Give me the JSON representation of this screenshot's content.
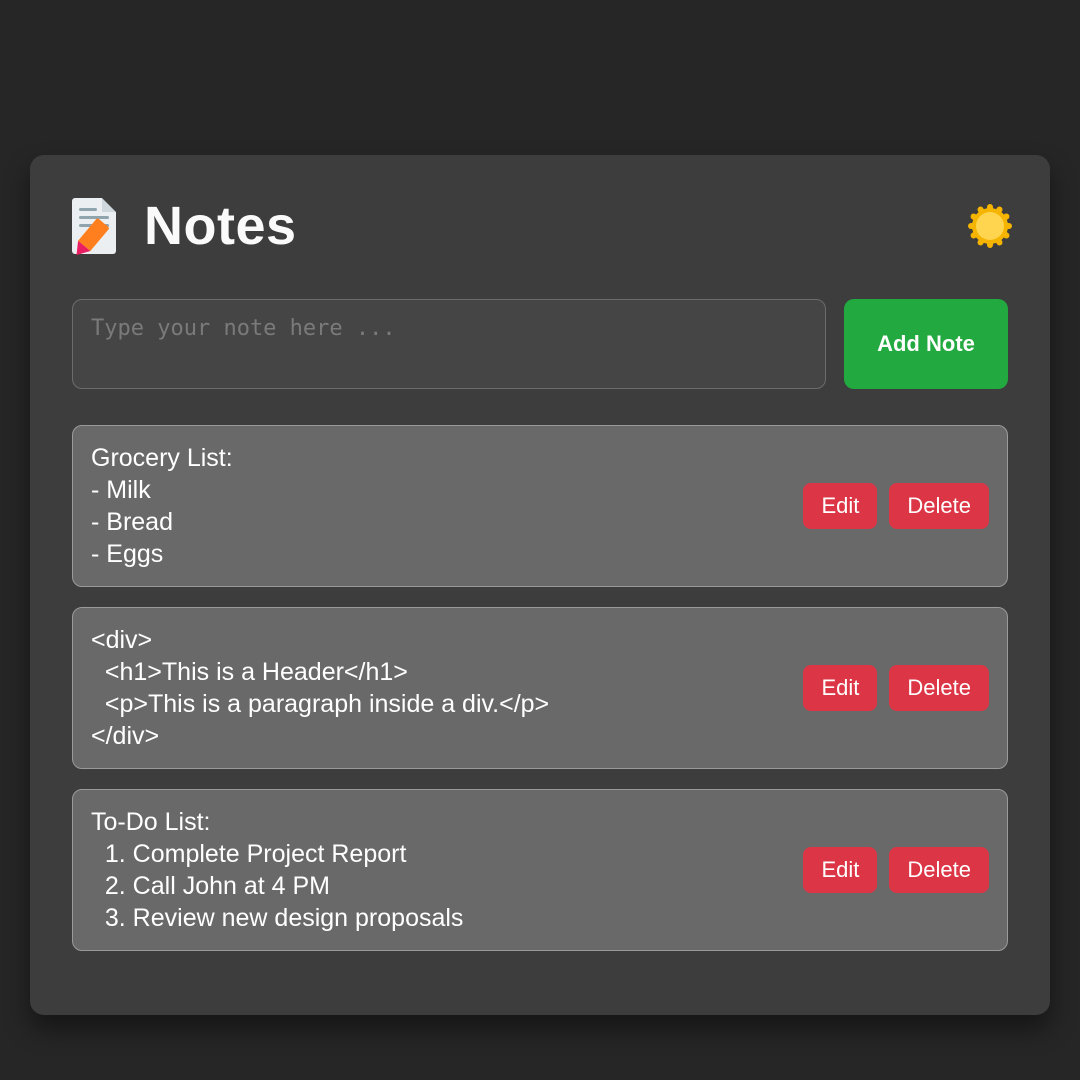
{
  "header": {
    "title": "Notes",
    "theme_icon": "sun-icon"
  },
  "input": {
    "placeholder": "Type your note here ...",
    "add_label": "Add Note"
  },
  "buttons": {
    "edit": "Edit",
    "delete": "Delete"
  },
  "notes": [
    {
      "text": "Grocery List:\n- Milk\n- Bread\n- Eggs"
    },
    {
      "text": "<div>\n  <h1>This is a Header</h1>\n  <p>This is a paragraph inside a div.</p>\n</div>"
    },
    {
      "text": "To-Do List:\n  1. Complete Project Report\n  2. Call John at 4 PM\n  3. Review new design proposals"
    }
  ]
}
